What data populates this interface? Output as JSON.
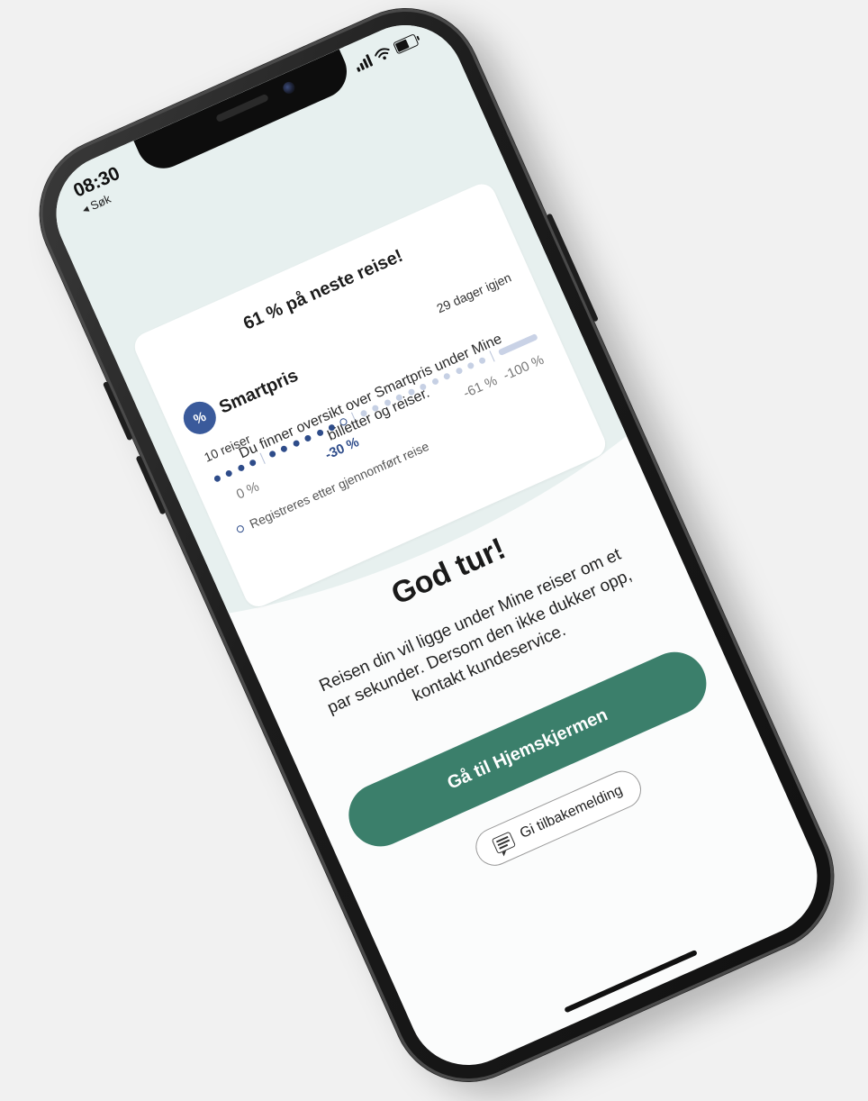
{
  "status_bar": {
    "time": "08:30",
    "back_label": "◂ Søk"
  },
  "card": {
    "headline": "61 % på neste reise!",
    "smartpris": {
      "badge": "%",
      "name": "Smartpris",
      "days_left": "29 dager igjen",
      "trips": "10 reiser",
      "progress_trips_completed": 10,
      "ticks": {
        "zero": "0 %",
        "thirty": "-30 %",
        "sixty_one": "-61 %",
        "hundred": "-100 %"
      },
      "legend": "Registreres etter gjennomført reise"
    }
  },
  "overview_text": "Du finner oversikt over Smartpris under Mine billetter og reiser.",
  "main": {
    "title": "God tur!",
    "body": "Reisen din vil ligge under Mine reiser om et par sekunder. Dersom den ikke dukker opp, kontakt kundeservice.",
    "primary_button": "Gå til Hjemskjermen",
    "feedback_button": "Gi tilbakemelding"
  },
  "colors": {
    "primary": "#3b7f6b",
    "smartpris": "#2e4c8a",
    "top_background": "#e7f0ef"
  }
}
